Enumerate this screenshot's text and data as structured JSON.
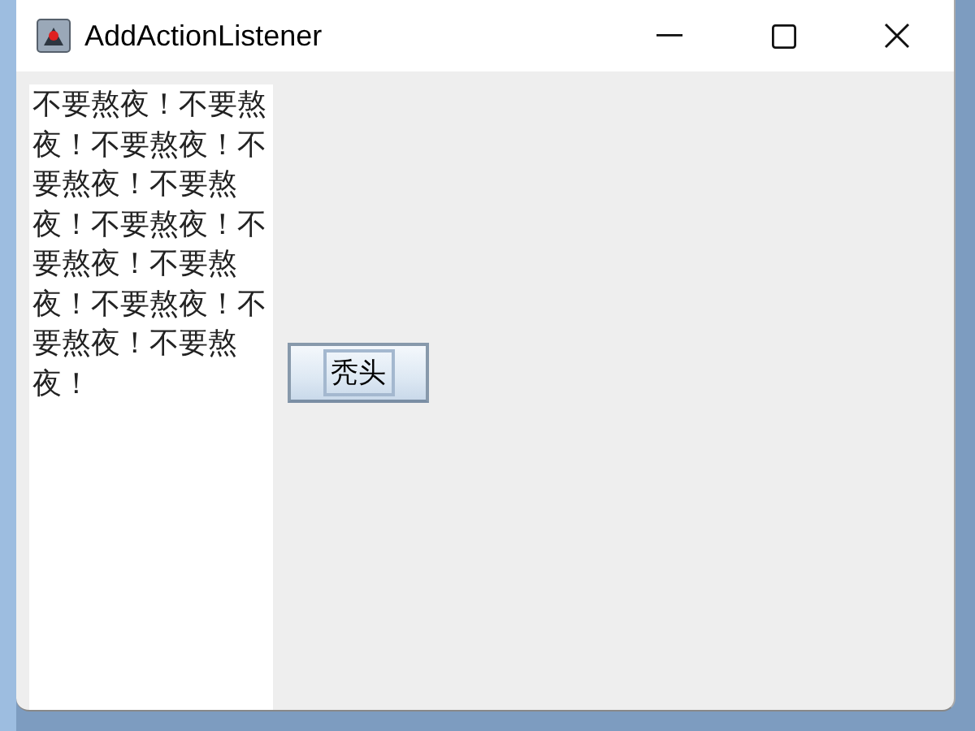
{
  "window": {
    "title": "AddActionListener"
  },
  "text_area": {
    "value": "不要熬夜！不要熬夜！不要熬夜！不要熬夜！不要熬夜！不要熬夜！不要熬夜！不要熬夜！不要熬夜！不要熬夜！不要熬夜！"
  },
  "button": {
    "label": "秃头",
    "focused": true
  }
}
